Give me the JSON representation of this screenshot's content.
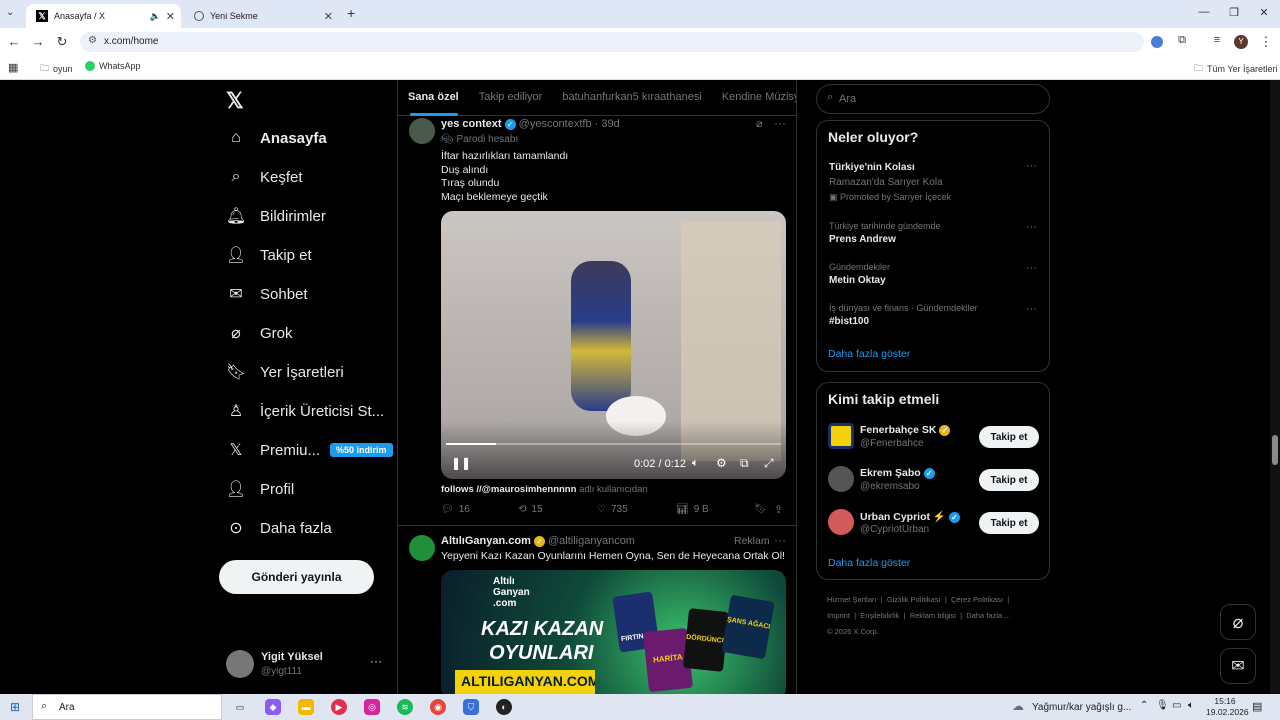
{
  "browser": {
    "tabs": [
      {
        "title": "Anasayfa / X"
      },
      {
        "title": "Yeni Sekme"
      }
    ],
    "new_tab": "+",
    "url": "x.com/home",
    "bookmarks": [
      "oyun",
      "WhatsApp"
    ],
    "all_bookmarks": "Tüm Yer İşaretleri",
    "profile_initial": "Y"
  },
  "sidebar": {
    "items": [
      {
        "label": "Anasayfa"
      },
      {
        "label": "Keşfet"
      },
      {
        "label": "Bildirimler"
      },
      {
        "label": "Takip et"
      },
      {
        "label": "Sohbet"
      },
      {
        "label": "Grok"
      },
      {
        "label": "Yer İşaretleri"
      },
      {
        "label": "İçerik Üreticisi St..."
      },
      {
        "label": "Premiu..."
      },
      {
        "label": "Profil"
      },
      {
        "label": "Daha fazla"
      }
    ],
    "premium_badge": "%50 indirim",
    "post_button": "Gönderi yayınla",
    "user": {
      "name": "Yigit Yüksel",
      "handle": "@yigt111"
    }
  },
  "feed": {
    "tabs": [
      "Sana özel",
      "Takip ediliyor",
      "batuhanfurkan5 kıraathanesi",
      "Kendine Müzisye"
    ],
    "post1": {
      "name": "yes context",
      "handle": "@yescontextfb",
      "time": "39d",
      "label": "Parodi hesabı",
      "lines": [
        "İftar hazırlıkları tamamlandı",
        "Duş alındı",
        "Tıraş olundu",
        "Maçı beklemeye geçtik"
      ],
      "video_time": "0:02 / 0:12",
      "video_progress": 0.15,
      "follows_user": "follows //@maurosimhennnnn",
      "follows_suffix": "adlı kullanıcıdan",
      "replies": "16",
      "reposts": "15",
      "likes": "735",
      "views": "9 B"
    },
    "post2": {
      "name": "AltılıGanyan.com",
      "handle": "@altiliganyancom",
      "ad": "Reklam",
      "text": "Yepyeni Kazı Kazan Oyunlarını Hemen Oyna, Sen de Heyecana Ortak Ol!",
      "banner_brand": "Altılı Ganyan .com",
      "banner_title1": "KAZI KAZAN",
      "banner_title2": "OYUNLARI",
      "banner_sub": "ALTILIGANYAN.COM'DA",
      "cards": [
        "FIRTINASI",
        "HARİTA",
        "DÖRDÜNCÜ",
        "ŞANS AĞACI"
      ]
    }
  },
  "right": {
    "search_placeholder": "Ara",
    "whats_happening": "Neler oluyor?",
    "trends": [
      {
        "title": "Türkiye'nin Kolası",
        "sub": "Ramazan'da Sarıyer Kola",
        "promo": "Promoted by Sarıyer İçecek"
      },
      {
        "context": "Türkiye tarihinde gündemde",
        "title": "Prens Andrew"
      },
      {
        "context": "Gündemdekiler",
        "title": "Metin Oktay"
      },
      {
        "context": "İş dünyası ve finans · Gündemdekiler",
        "title": "#bist100"
      }
    ],
    "show_more": "Daha fazla göster",
    "who_to_follow": "Kimi takip etmeli",
    "suggestions": [
      {
        "name": "Fenerbahçe SK",
        "handle": "@Fenerbahce",
        "button": "Takip et"
      },
      {
        "name": "Ekrem Şabo",
        "handle": "@ekremsabo",
        "button": "Takip et"
      },
      {
        "name": "Urban Cypriot ⚡",
        "handle": "@CypriotUrban",
        "button": "Takip et"
      }
    ],
    "show_more2": "Daha fazla göster",
    "footer": [
      "Hizmet Şartları",
      "Gizlilik Politikası",
      "Çerez Politikası",
      "Imprint",
      "Erişilebilirlik",
      "Reklam bilgisi",
      "Daha fazla ..."
    ],
    "copyright": "© 2026 X Corp."
  },
  "taskbar": {
    "search": "Ara",
    "weather": "Yağmur/kar yağışlı g...",
    "time": "15:16",
    "date": "19.02.2026"
  }
}
